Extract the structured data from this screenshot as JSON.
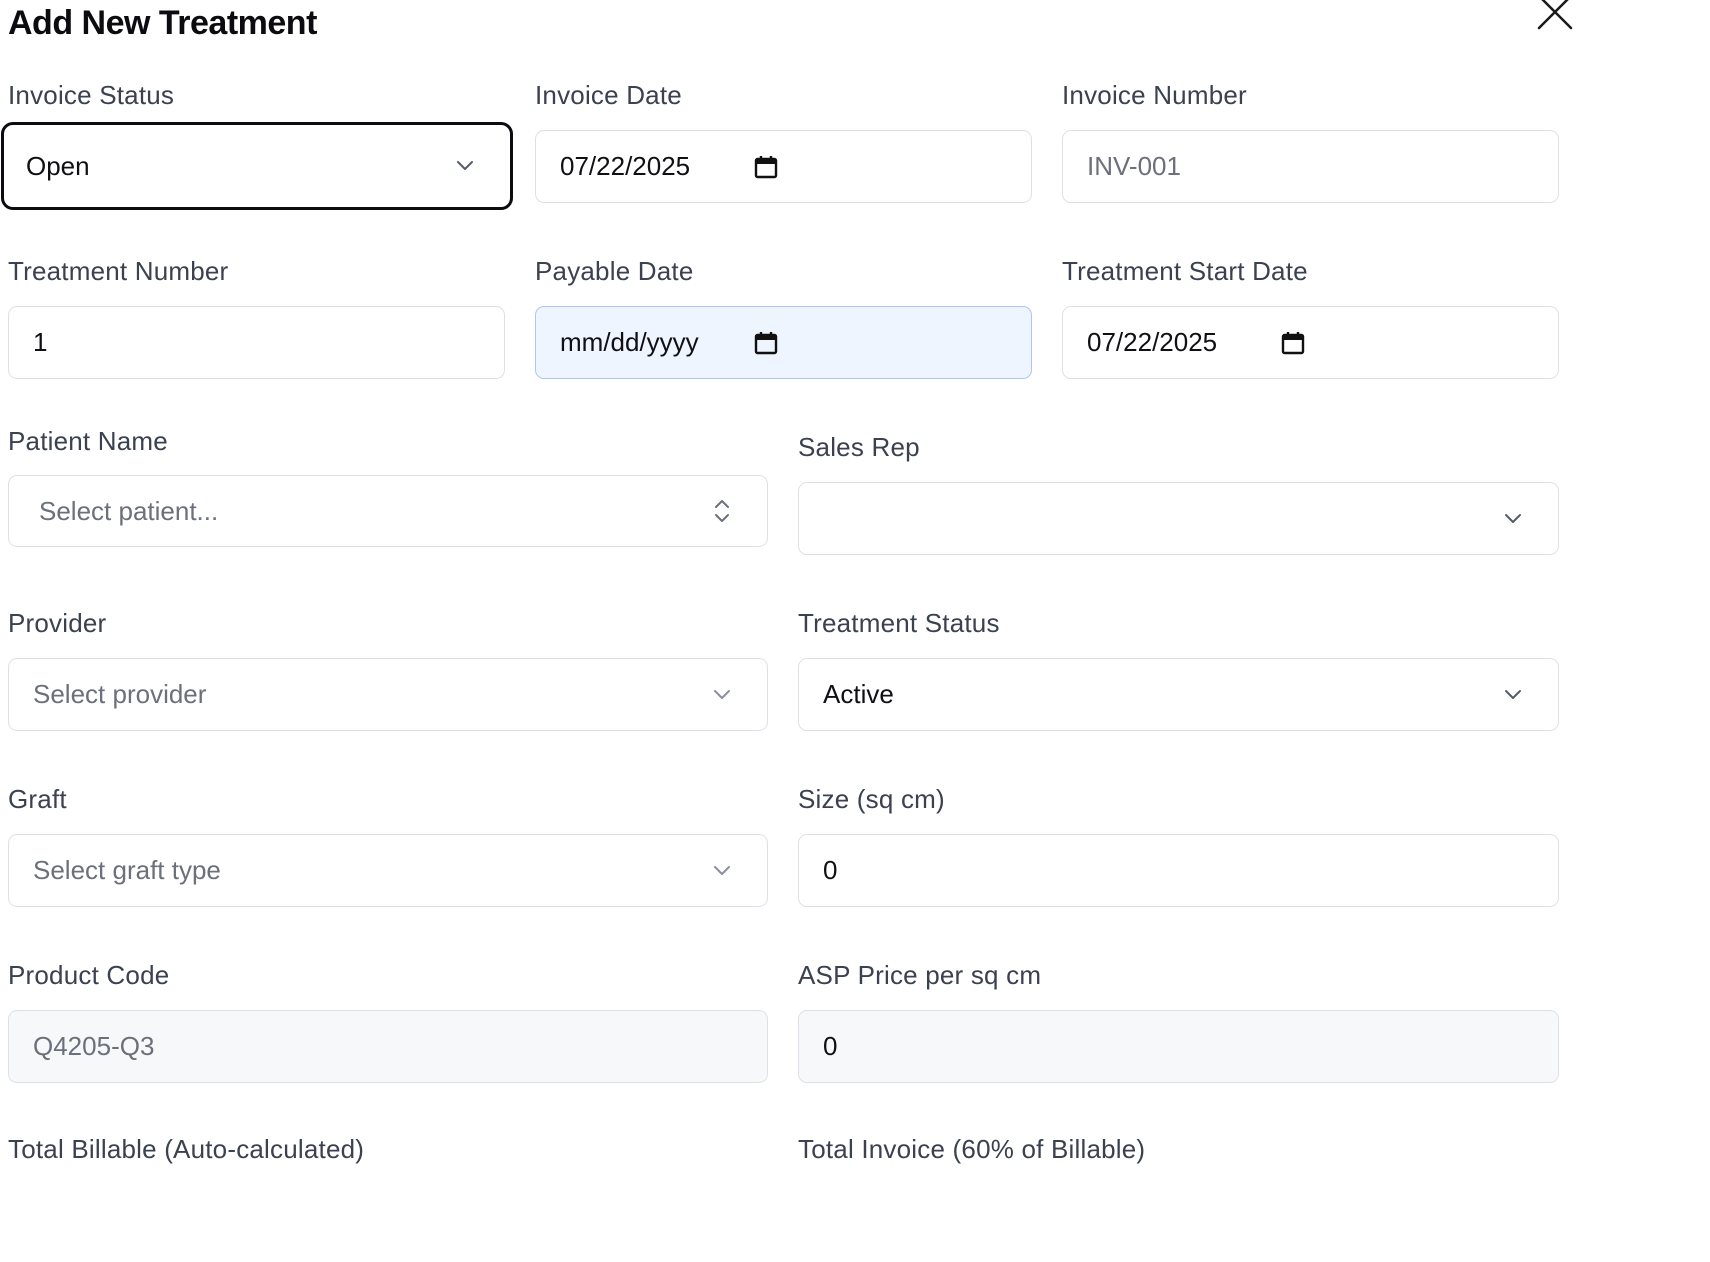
{
  "dialog": {
    "title": "Add New Treatment",
    "close_icon": "close-icon"
  },
  "fields": {
    "invoice_status": {
      "label": "Invoice Status",
      "value": "Open"
    },
    "invoice_date": {
      "label": "Invoice Date",
      "value": "07/22/2025"
    },
    "invoice_number": {
      "label": "Invoice Number",
      "placeholder": "INV-001"
    },
    "treatment_number": {
      "label": "Treatment Number",
      "value": "1"
    },
    "payable_date": {
      "label": "Payable Date",
      "placeholder": "mm/dd/yyyy"
    },
    "treatment_start_date": {
      "label": "Treatment Start Date",
      "value": "07/22/2025"
    },
    "patient_name": {
      "label": "Patient Name",
      "placeholder": "Select patient..."
    },
    "sales_rep": {
      "label": "Sales Rep",
      "value": ""
    },
    "provider": {
      "label": "Provider",
      "placeholder": "Select provider"
    },
    "treatment_status": {
      "label": "Treatment Status",
      "value": "Active"
    },
    "graft": {
      "label": "Graft",
      "placeholder": "Select graft type"
    },
    "size": {
      "label": "Size (sq cm)",
      "value": "0"
    },
    "product_code": {
      "label": "Product Code",
      "placeholder": "Q4205-Q3"
    },
    "asp_price": {
      "label": "ASP Price per sq cm",
      "value": "0"
    },
    "total_billable": {
      "label": "Total Billable (Auto-calculated)"
    },
    "total_invoice": {
      "label": "Total Invoice (60% of Billable)"
    }
  }
}
